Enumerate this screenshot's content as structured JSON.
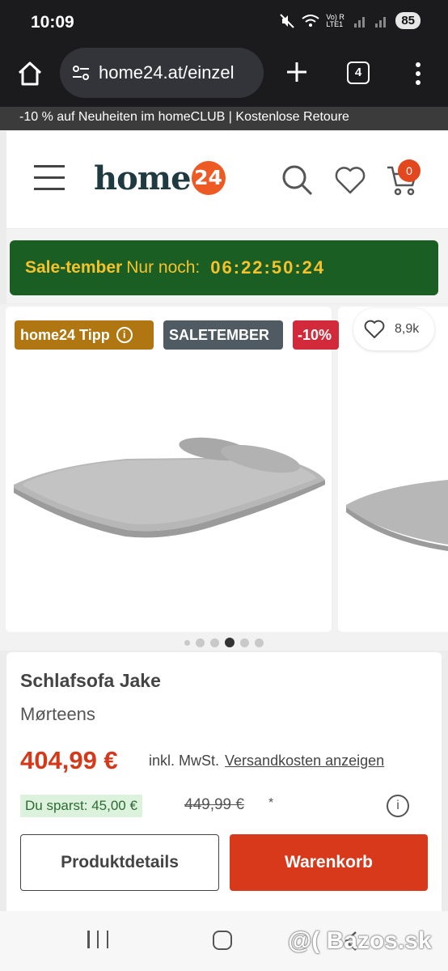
{
  "status_bar": {
    "time": "10:09",
    "network_label": "Vo) R LTE1",
    "battery": "85"
  },
  "browser": {
    "url": "home24.at/einzel",
    "tab_count": "4"
  },
  "promo_banner": {
    "text": "-10 % auf Neuheiten im homeCLUB | Kostenlose Retoure"
  },
  "header": {
    "logo_word": "home",
    "logo_number": "24",
    "cart_count": "0"
  },
  "sale_banner": {
    "label_bold": "Sale-tember",
    "label_text": "Nur noch:",
    "timer": "06:22:50:24"
  },
  "gallery": {
    "badges": {
      "tipp": "home24 Tipp",
      "tipp_info": "i",
      "saletember": "SALETEMBER",
      "discount": "-10%"
    },
    "wishlist_count": "8,9k",
    "dots_total": 6,
    "active_dot": 4
  },
  "product": {
    "title": "Schlafsofa Jake",
    "brand": "Mørteens",
    "price": "404,99 €",
    "vat_text": "inkl. MwSt.",
    "shipping_link": "Versandkosten anzeigen",
    "savings": "Du sparst: 45,00 €",
    "old_price": "449,99 €",
    "footnote_mark": "*",
    "info_icon_text": "i"
  },
  "buttons": {
    "details": "Produktdetails",
    "cart": "Warenkorb"
  },
  "watermark": {
    "text": "@( Bazos.sk"
  },
  "colors": {
    "accent": "#d9391b",
    "sale_green": "#1b5e24",
    "sale_yellow": "#f5c22b",
    "tipp_badge": "#b07612",
    "discount_badge": "#d22a3b"
  }
}
